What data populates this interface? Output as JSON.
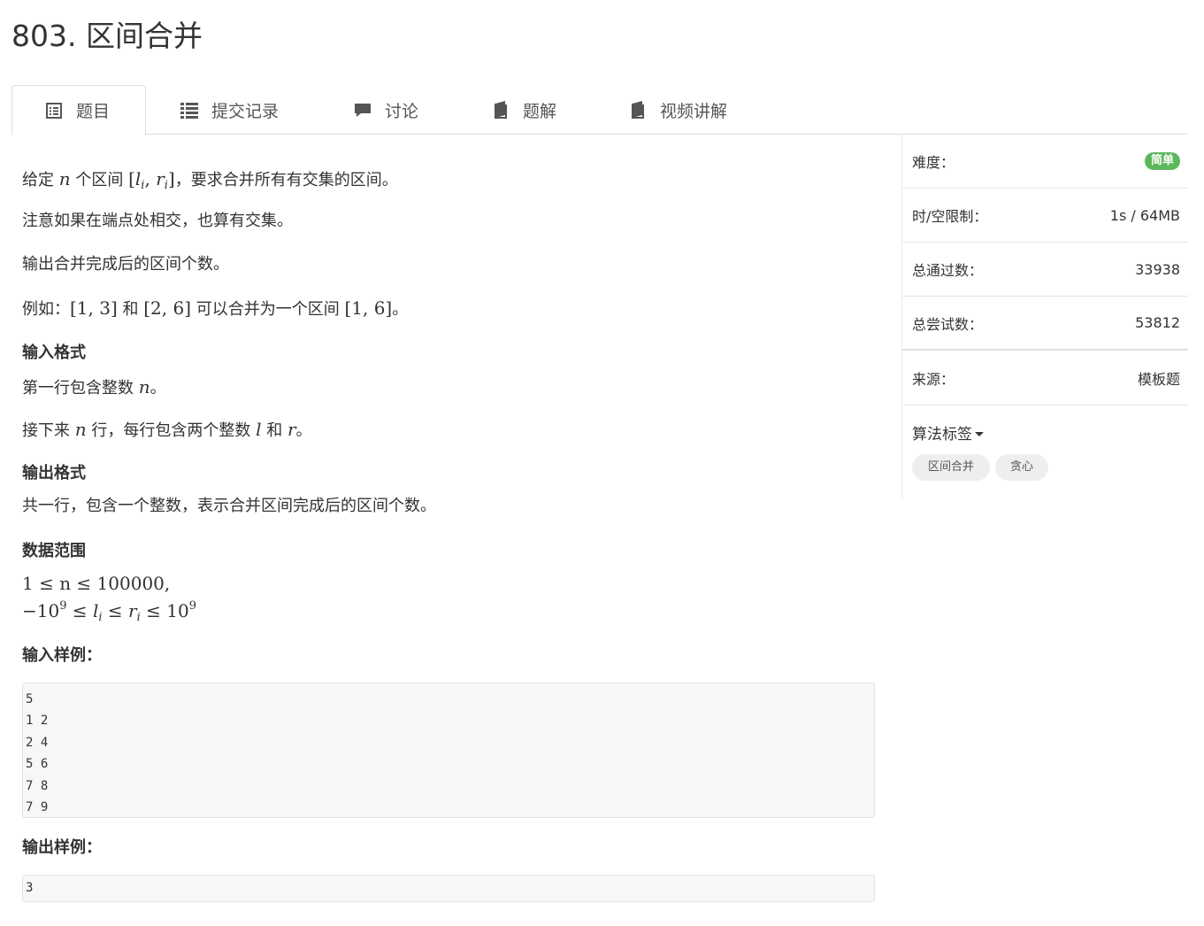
{
  "page": {
    "title": "803. 区间合并"
  },
  "tabs": [
    {
      "label": "题目",
      "icon": "problem-list-icon",
      "active": true
    },
    {
      "label": "提交记录",
      "icon": "list-icon"
    },
    {
      "label": "讨论",
      "icon": "comment-icon"
    },
    {
      "label": "题解",
      "icon": "book-icon"
    },
    {
      "label": "视频讲解",
      "icon": "book-icon"
    }
  ],
  "problem": {
    "desc1": {
      "pre": "给定 ",
      "n": "n",
      "mid": " 个区间 ",
      "post": "，要求合并所有有交集的区间。"
    },
    "desc2": "注意如果在端点处相交，也算有交集。",
    "desc3": "输出合并完成后的区间个数。",
    "example": {
      "pre": "例如：",
      "a": "[1, 3]",
      "and": " 和 ",
      "b": "[2, 6]",
      "mid": " 可以合并为一个区间 ",
      "c": "[1, 6]",
      "post": "。"
    },
    "input_heading": "输入格式",
    "input1": {
      "pre": "第一行包含整数 ",
      "n": "n",
      "post": "。"
    },
    "input2": {
      "pre": "接下来 ",
      "n": "n",
      "mid": " 行，每行包含两个整数 ",
      "l": "l",
      "and": " 和 ",
      "r": "r",
      "post": "。"
    },
    "output_heading": "输出格式",
    "output1": "共一行，包含一个整数，表示合并区间完成后的区间个数。",
    "range_heading": "数据范围",
    "range1": "1 ≤ n ≤ 100000,",
    "sample_input_heading": "输入样例：",
    "sample_input": [
      "5",
      "1 2",
      "2 4",
      "5 6",
      "7 8",
      "7 9"
    ],
    "sample_output_heading": "输出样例：",
    "sample_output": [
      "3"
    ]
  },
  "sidebar": {
    "difficulty_label": "难度：",
    "difficulty_value": "简单",
    "difficulty_color": "#5cb85c",
    "limit_label": "时/空限制：",
    "limit_value": "1s / 64MB",
    "passed_label": "总通过数：",
    "passed_value": "33938",
    "tried_label": "总尝试数：",
    "tried_value": "53812",
    "source_label": "来源：",
    "source_value": "模板题",
    "tags_title": "算法标签",
    "tags": [
      "区间合并",
      "贪心"
    ]
  }
}
